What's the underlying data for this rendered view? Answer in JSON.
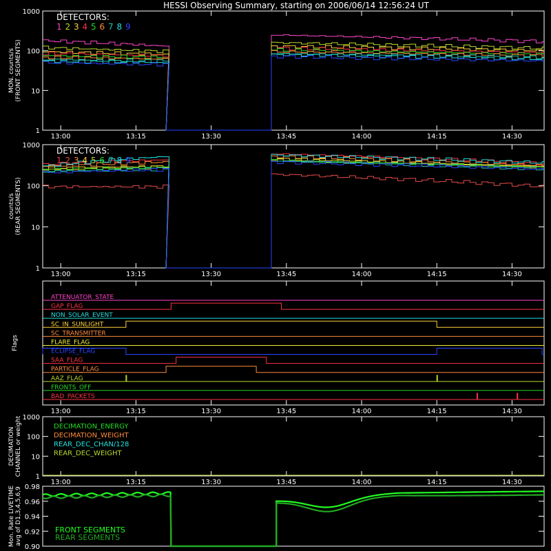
{
  "title": "HESSI Observing Summary, starting on 2006/06/14 12:56:24 UT",
  "colors": {
    "det": [
      "#ff3344",
      "#e34a4a",
      "#ff8c3a",
      "#ffd23a",
      "#b9d92c",
      "#22dd22",
      "#20c8a8",
      "#22e0e0",
      "#2a44ff"
    ],
    "mon_front": [
      "#ff44cc",
      "#b9d92c",
      "#ffd23a",
      "#ff3344",
      "#22dd22",
      "#ff8c3a",
      "#20c8a8",
      "#22e0e0",
      "#2a44ff"
    ],
    "frame": "#ffffff"
  },
  "chart_data": [
    {
      "type": "line",
      "id": "front",
      "ylabel": [
        "MON. counts/s",
        "(FRONT SEGMENTS)"
      ],
      "yscale": "log",
      "ylim": [
        1,
        1000
      ],
      "yticks": [
        "1",
        "10",
        "100",
        "1000"
      ],
      "xticks": [
        "13:00",
        "13:15",
        "13:30",
        "13:45",
        "14:00",
        "14:15",
        "14:30"
      ],
      "legend_title": "DETECTORS:",
      "legend_items": [
        "1",
        "2",
        "3",
        "4",
        "5",
        "6",
        "7",
        "8",
        "9"
      ],
      "gap": [
        "13:21",
        "13:42"
      ],
      "series": [
        {
          "start": 180,
          "end": 130,
          "after_start": 250,
          "after_end": 170
        },
        {
          "start": 120,
          "end": 95,
          "after_start": 160,
          "after_end": 115
        },
        {
          "start": 95,
          "end": 80,
          "after_start": 130,
          "after_end": 100
        },
        {
          "start": 85,
          "end": 75,
          "after_start": 115,
          "after_end": 90
        },
        {
          "start": 75,
          "end": 68,
          "after_start": 105,
          "after_end": 82
        },
        {
          "start": 68,
          "end": 62,
          "after_start": 95,
          "after_end": 75
        },
        {
          "start": 60,
          "end": 55,
          "after_start": 85,
          "after_end": 68
        },
        {
          "start": 55,
          "end": 50,
          "after_start": 80,
          "after_end": 62
        },
        {
          "start": 50,
          "end": 45,
          "after_start": 72,
          "after_end": 55
        }
      ]
    },
    {
      "type": "line",
      "id": "rear",
      "ylabel": [
        "counts/s",
        "(REAR SEGMENTS)"
      ],
      "yscale": "log",
      "ylim": [
        1,
        1000
      ],
      "yticks": [
        "1",
        "10",
        "100",
        "1000"
      ],
      "xticks": [
        "13:00",
        "13:15",
        "13:30",
        "13:45",
        "14:00",
        "14:15",
        "14:30"
      ],
      "legend_title": "DETECTORS:",
      "legend_items": [
        "1",
        "2",
        "3",
        "4",
        "5",
        "6",
        "7",
        "8",
        "9"
      ],
      "gap": [
        "13:21",
        "13:42"
      ],
      "series": [
        {
          "start": 330,
          "end": 430,
          "after_start": 600,
          "after_end": 340
        },
        {
          "start": 95,
          "end": 95,
          "after_start": 190,
          "after_end": 95
        },
        {
          "start": 300,
          "end": 380,
          "after_start": 520,
          "after_end": 310
        },
        {
          "start": 260,
          "end": 300,
          "after_start": 440,
          "after_end": 290
        },
        {
          "start": 250,
          "end": 290,
          "after_start": 430,
          "after_end": 280
        },
        {
          "start": 240,
          "end": 280,
          "after_start": 410,
          "after_end": 270
        },
        {
          "start": 220,
          "end": 260,
          "after_start": 400,
          "after_end": 260
        },
        {
          "start": 300,
          "end": 520,
          "after_start": 560,
          "after_end": 360
        },
        {
          "start": 210,
          "end": 250,
          "after_start": 380,
          "after_end": 250
        }
      ]
    },
    {
      "type": "flags",
      "id": "flags",
      "ylabel": [
        "Flags"
      ],
      "xticks": [
        "13:00",
        "13:15",
        "13:30",
        "13:45",
        "14:00",
        "14:15",
        "14:30"
      ],
      "rows": [
        {
          "label": "ATTENUATOR_STATE",
          "color": "#ff44cc",
          "segments": []
        },
        {
          "label": "GAP_FLAG",
          "color": "#ff3344",
          "segments": [
            [
              "13:22",
              "13:44"
            ]
          ]
        },
        {
          "label": "NON_SOLAR_EVENT",
          "color": "#22e0e0",
          "segments": []
        },
        {
          "label": "SC_IN_SUNLIGHT",
          "color": "#ffd23a",
          "segments": [
            [
              "13:13",
              "14:15"
            ]
          ]
        },
        {
          "label": "SC_TRANSMITTER",
          "color": "#ff8c3a",
          "segments": []
        },
        {
          "label": "FLARE_FLAG",
          "color": "#eeee33",
          "segments": []
        },
        {
          "label": "ECLIPSE_FLAG",
          "color": "#2a44ff",
          "segments": [
            [
              "12:56",
              "13:13"
            ],
            [
              "14:15",
              "14:36"
            ]
          ]
        },
        {
          "label": "SAA_FLAG",
          "color": "#ff3344",
          "segments": [
            [
              "13:23",
              "13:41"
            ]
          ]
        },
        {
          "label": "PARTICLE_FLAG",
          "color": "#ff8c3a",
          "segments": [
            [
              "13:21",
              "13:39"
            ]
          ]
        },
        {
          "label": "AAZ_FLAG",
          "color": "#b9d92c",
          "segments": [
            [
              "13:13",
              "13:13"
            ],
            [
              "14:15",
              "14:15"
            ]
          ]
        },
        {
          "label": "FRONTS_OFF",
          "color": "#22dd22",
          "segments": []
        },
        {
          "label": "BAD_PACKETS",
          "color": "#ff3344",
          "segments": [
            [
              "14:23",
              "14:23"
            ],
            [
              "14:31",
              "14:31"
            ]
          ]
        }
      ]
    },
    {
      "type": "line",
      "id": "decim",
      "ylabel": [
        "DECIMATION",
        "CHANNEL or weight"
      ],
      "yscale": "log",
      "ylim": [
        1,
        1000
      ],
      "yticks": [
        "1",
        "10",
        "100",
        "1000"
      ],
      "xticks": [
        "13:00",
        "13:15",
        "13:30",
        "13:45",
        "14:00",
        "14:15",
        "14:30"
      ],
      "legend": [
        {
          "label": "DECIMATION_ENERGY",
          "color": "#22dd22"
        },
        {
          "label": "DECIMATION_WEIGHT",
          "color": "#ff8c3a"
        },
        {
          "label": "REAR_DEC_CHAN/128",
          "color": "#22e0e0"
        },
        {
          "label": "REAR_DEC_WEIGHT",
          "color": "#b9d92c"
        }
      ]
    },
    {
      "type": "line",
      "id": "live",
      "ylabel": [
        "Mon. Rate LIVETIME",
        "avg of D1,3,4,5,6,9"
      ],
      "ylim": [
        0.9,
        0.98
      ],
      "yticks": [
        "0.90",
        "0.92",
        "0.94",
        "0.96",
        "0.98"
      ],
      "gap": [
        "13:22",
        "13:43"
      ],
      "series": [
        {
          "name": "FRONT SEGMENTS",
          "color": "#22ff22",
          "start": 0.968,
          "end": 0.971,
          "after_start": 0.962,
          "dip": 0.952,
          "after_end": 0.972
        },
        {
          "name": "REAR SEGMENTS",
          "color": "#22aa22",
          "start": 0.965,
          "end": 0.968,
          "after_start": 0.958,
          "dip": 0.945,
          "after_end": 0.969
        }
      ]
    }
  ]
}
